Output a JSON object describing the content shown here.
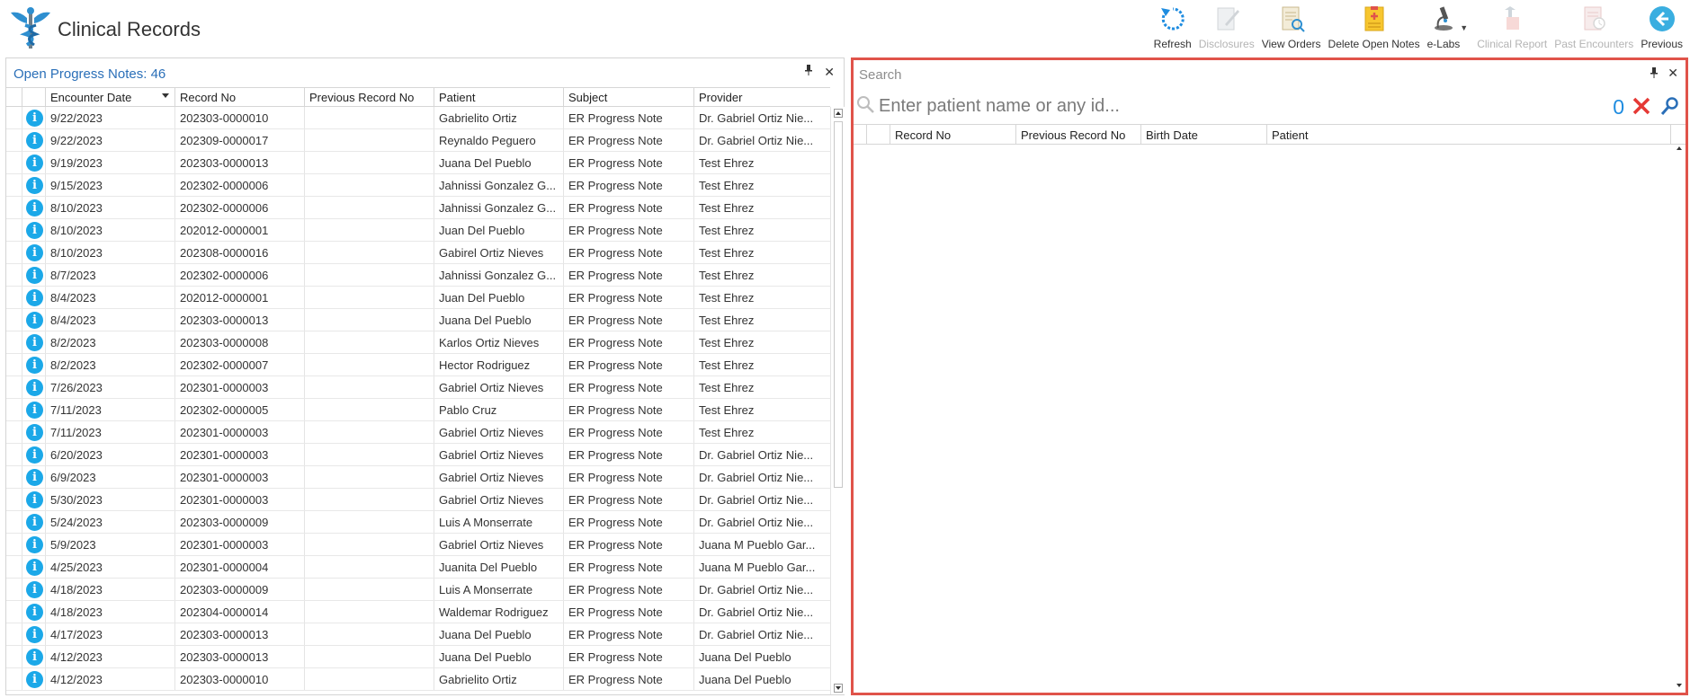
{
  "app": {
    "title": "Clinical Records"
  },
  "toolbar": {
    "items": [
      {
        "label": "Refresh",
        "icon": "refresh-icon",
        "enabled": true
      },
      {
        "label": "Disclosures",
        "icon": "disclosures-icon",
        "enabled": false
      },
      {
        "label": "View Orders",
        "icon": "view-orders-icon",
        "enabled": true
      },
      {
        "label": "Delete Open Notes",
        "icon": "delete-notes-icon",
        "enabled": true
      },
      {
        "label": "e-Labs",
        "icon": "microscope-icon",
        "enabled": true
      },
      {
        "label": "Clinical Report",
        "icon": "clinical-report-icon",
        "enabled": false
      },
      {
        "label": "Past Encounters",
        "icon": "past-encounters-icon",
        "enabled": false
      },
      {
        "label": "Previous",
        "icon": "previous-arrow-icon",
        "enabled": true
      }
    ]
  },
  "left_pane": {
    "title_label": "Open Progress Notes:",
    "count": "46",
    "pin_glyph": "📌",
    "close_glyph": "✕",
    "columns": [
      "Encounter Date",
      "Record No",
      "Previous Record No",
      "Patient",
      "Subject",
      "Provider"
    ],
    "rows": [
      [
        "9/22/2023",
        "202303-0000010",
        "",
        "Gabrielito Ortiz",
        "ER Progress Note",
        "Dr. Gabriel Ortiz Nie..."
      ],
      [
        "9/22/2023",
        "202309-0000017",
        "",
        "Reynaldo Peguero",
        "ER Progress Note",
        "Dr. Gabriel Ortiz Nie..."
      ],
      [
        "9/19/2023",
        "202303-0000013",
        "",
        "Juana Del Pueblo",
        "ER Progress Note",
        "Test Ehrez"
      ],
      [
        "9/15/2023",
        "202302-0000006",
        "",
        "Jahnissi Gonzalez G...",
        "ER Progress Note",
        "Test Ehrez"
      ],
      [
        "8/10/2023",
        "202302-0000006",
        "",
        "Jahnissi Gonzalez G...",
        "ER Progress Note",
        "Test Ehrez"
      ],
      [
        "8/10/2023",
        "202012-0000001",
        "",
        "Juan Del Pueblo",
        "ER Progress Note",
        "Test Ehrez"
      ],
      [
        "8/10/2023",
        "202308-0000016",
        "",
        "Gabirel Ortiz Nieves",
        "ER Progress Note",
        "Test Ehrez"
      ],
      [
        "8/7/2023",
        "202302-0000006",
        "",
        "Jahnissi Gonzalez G...",
        "ER Progress Note",
        "Test Ehrez"
      ],
      [
        "8/4/2023",
        "202012-0000001",
        "",
        "Juan Del Pueblo",
        "ER Progress Note",
        "Test Ehrez"
      ],
      [
        "8/4/2023",
        "202303-0000013",
        "",
        "Juana Del Pueblo",
        "ER Progress Note",
        "Test Ehrez"
      ],
      [
        "8/2/2023",
        "202303-0000008",
        "",
        "Karlos Ortiz Nieves",
        "ER Progress Note",
        "Test Ehrez"
      ],
      [
        "8/2/2023",
        "202302-0000007",
        "",
        "Hector Rodriguez",
        "ER Progress Note",
        "Test Ehrez"
      ],
      [
        "7/26/2023",
        "202301-0000003",
        "",
        "Gabriel Ortiz Nieves",
        "ER Progress Note",
        "Test Ehrez"
      ],
      [
        "7/11/2023",
        "202302-0000005",
        "",
        "Pablo Cruz",
        "ER Progress Note",
        "Test Ehrez"
      ],
      [
        "7/11/2023",
        "202301-0000003",
        "",
        "Gabriel Ortiz Nieves",
        "ER Progress Note",
        "Test Ehrez"
      ],
      [
        "6/20/2023",
        "202301-0000003",
        "",
        "Gabriel Ortiz Nieves",
        "ER Progress Note",
        "Dr. Gabriel Ortiz Nie..."
      ],
      [
        "6/9/2023",
        "202301-0000003",
        "",
        "Gabriel Ortiz Nieves",
        "ER Progress Note",
        "Dr. Gabriel Ortiz Nie..."
      ],
      [
        "5/30/2023",
        "202301-0000003",
        "",
        "Gabriel Ortiz Nieves",
        "ER Progress Note",
        "Dr. Gabriel Ortiz Nie..."
      ],
      [
        "5/24/2023",
        "202303-0000009",
        "",
        "Luis A Monserrate",
        "ER Progress Note",
        "Dr. Gabriel Ortiz Nie..."
      ],
      [
        "5/9/2023",
        "202301-0000003",
        "",
        "Gabriel Ortiz Nieves",
        "ER Progress Note",
        "Juana M Pueblo Gar..."
      ],
      [
        "4/25/2023",
        "202301-0000004",
        "",
        "Juanita Del Pueblo",
        "ER Progress Note",
        "Juana M Pueblo Gar..."
      ],
      [
        "4/18/2023",
        "202303-0000009",
        "",
        "Luis A Monserrate",
        "ER Progress Note",
        "Dr. Gabriel Ortiz Nie..."
      ],
      [
        "4/18/2023",
        "202304-0000014",
        "",
        "Waldemar Rodriguez",
        "ER Progress Note",
        "Dr. Gabriel Ortiz Nie..."
      ],
      [
        "4/17/2023",
        "202303-0000013",
        "",
        "Juana Del Pueblo",
        "ER Progress Note",
        "Dr. Gabriel Ortiz Nie..."
      ],
      [
        "4/12/2023",
        "202303-0000013",
        "",
        "Juana Del Pueblo",
        "ER Progress Note",
        "Juana Del Pueblo"
      ],
      [
        "4/12/2023",
        "202303-0000010",
        "",
        "Gabrielito Ortiz",
        "ER Progress Note",
        "Juana Del Pueblo"
      ]
    ]
  },
  "right_pane": {
    "title": "Search",
    "pin_glyph": "📌",
    "close_glyph": "✕",
    "search_placeholder": "Enter patient name or any id...",
    "result_count": "0",
    "columns": [
      "Record No",
      "Previous Record No",
      "Birth Date",
      "Patient"
    ]
  },
  "colors": {
    "accent_blue": "#2a6fb8",
    "info_icon": "#1ba8e8",
    "highlight_border": "#e0534a",
    "clear_red": "#e53935"
  }
}
